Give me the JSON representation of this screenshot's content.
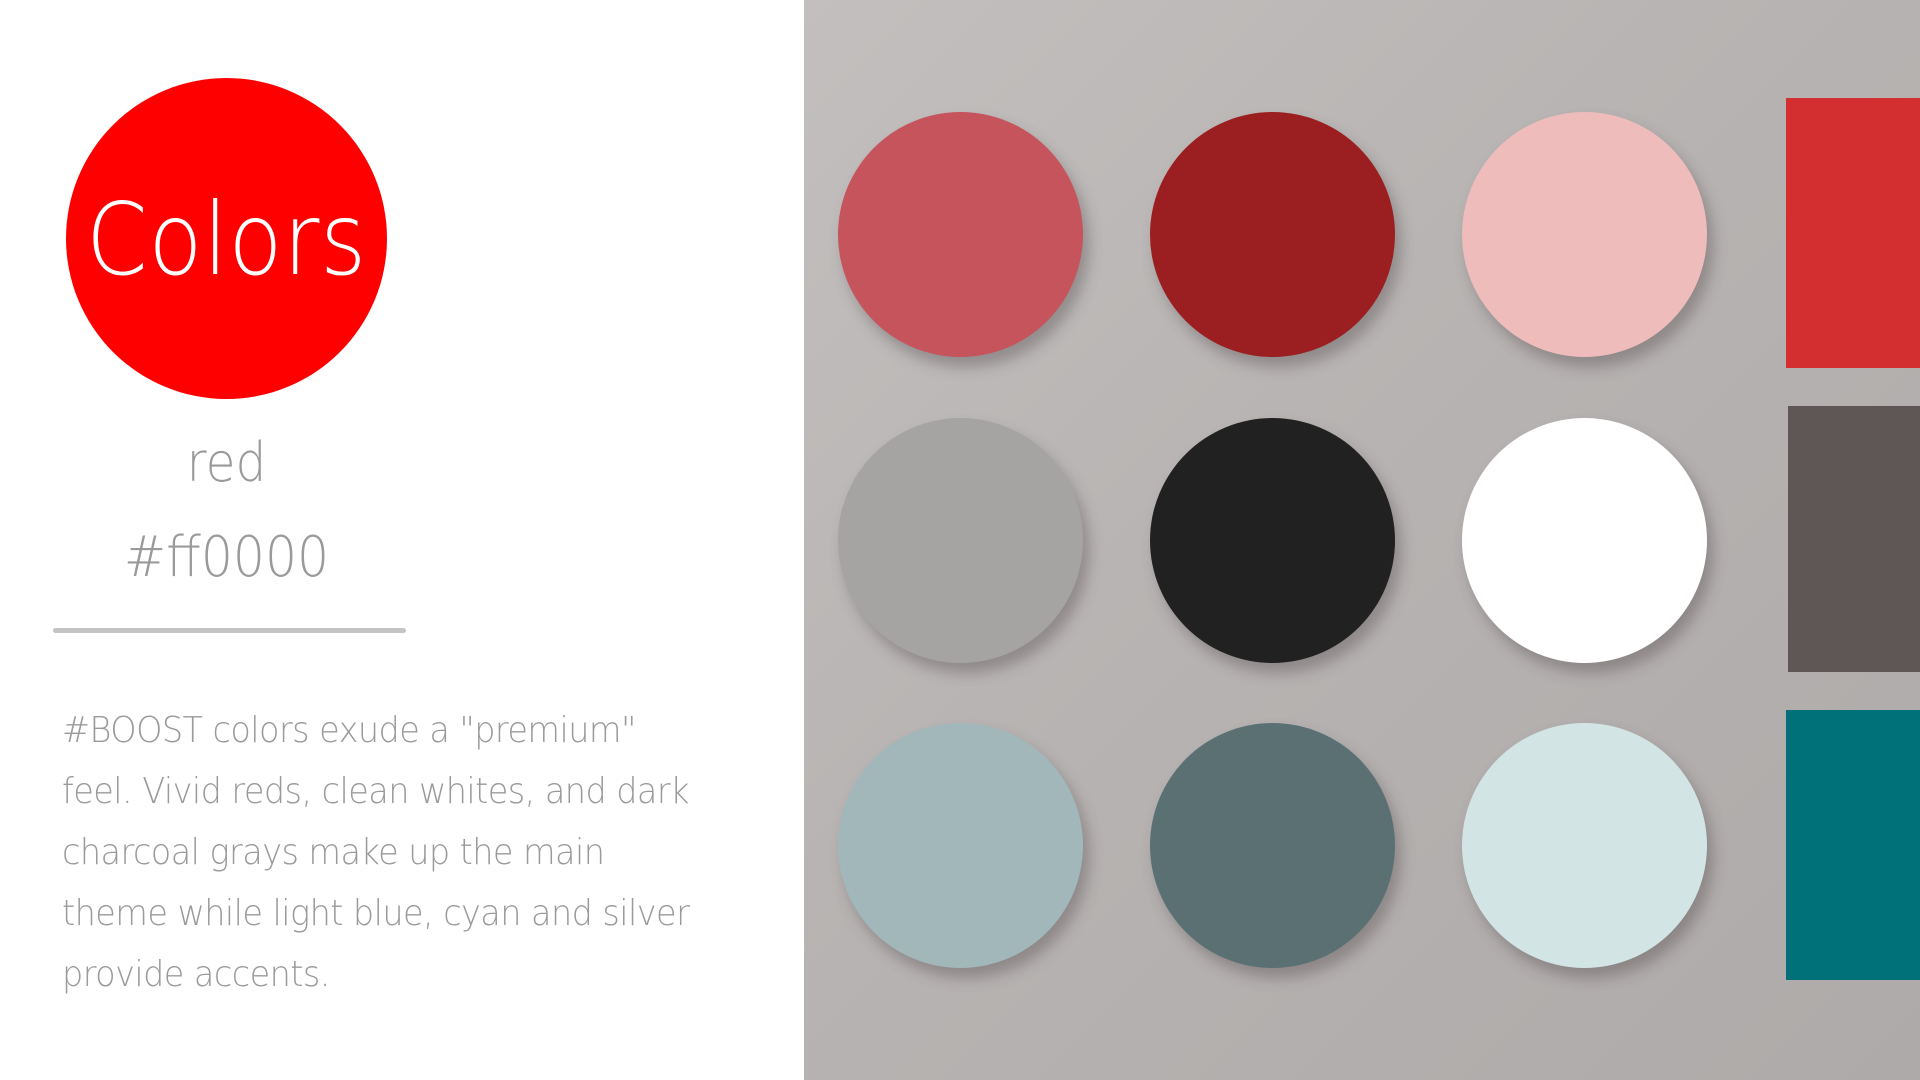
{
  "title": "Colors",
  "selected_color": {
    "name": "red",
    "hex": "#ff0000"
  },
  "description": "#BOOST colors exude a \"premium\" feel. Vivid reds, clean whites, and dark charcoal grays make up the main theme while light blue, cyan and silver provide accents.",
  "colors": {
    "title_circle": "#ff0000",
    "panel_background": "#b9b5b4",
    "text_gray": "#9a9a9a",
    "divider": "#c4c4c4"
  },
  "swatches": [
    {
      "color": "#c5545c"
    },
    {
      "color": "#9b1e20"
    },
    {
      "color": "#efbcbc"
    },
    {
      "color": "#a5a4a3"
    },
    {
      "color": "#212121"
    },
    {
      "color": "#ffffff"
    },
    {
      "color": "#a2b7ba"
    },
    {
      "color": "#5a7072"
    },
    {
      "color": "#d3e4e5"
    }
  ],
  "side_blocks": [
    {
      "color": "#d32f30"
    },
    {
      "color": "#5f5656"
    },
    {
      "color": "#007079"
    }
  ]
}
